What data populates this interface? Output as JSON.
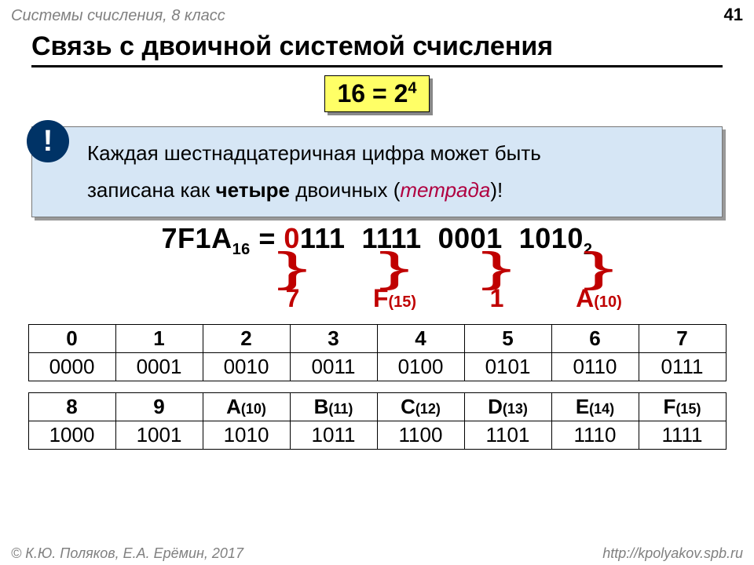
{
  "header": {
    "course": "Системы счисления, 8 класс",
    "page": "41"
  },
  "title": "Связь с двоичной системой счисления",
  "equation": {
    "lhs": "16 = 2",
    "exp": "4"
  },
  "info": {
    "bang": "!",
    "line1": "Каждая шестнадцатеричная цифра может быть",
    "line2a": "записана как ",
    "line2b": "четыре",
    "line2c": " двоичных (",
    "line2d": "тетрада",
    "line2e": ")!"
  },
  "hexline": {
    "lhs": "7F1A",
    "lhs_sub": "16",
    "eq": " = ",
    "lead": "0",
    "g1": "111",
    "sp": "  ",
    "g2": "1111",
    "g3": "0001",
    "g4": "1010",
    "rhs_sub": "2"
  },
  "groups": [
    {
      "label": "7",
      "sub": ""
    },
    {
      "label": "F",
      "sub": "(15)"
    },
    {
      "label": "1",
      "sub": ""
    },
    {
      "label": "A",
      "sub": "(10)"
    }
  ],
  "table1": {
    "head": [
      "0",
      "1",
      "2",
      "3",
      "4",
      "5",
      "6",
      "7"
    ],
    "row": [
      "0000",
      "0001",
      "0010",
      "0011",
      "0100",
      "0101",
      "0110",
      "0111"
    ]
  },
  "table2": {
    "head": [
      {
        "t": "8",
        "s": ""
      },
      {
        "t": "9",
        "s": ""
      },
      {
        "t": "A",
        "s": "(10)"
      },
      {
        "t": "B",
        "s": "(11)"
      },
      {
        "t": "C",
        "s": "(12)"
      },
      {
        "t": "D",
        "s": "(13)"
      },
      {
        "t": "E",
        "s": "(14)"
      },
      {
        "t": "F",
        "s": "(15)"
      }
    ],
    "row": [
      "1000",
      "1001",
      "1010",
      "1011",
      "1100",
      "1101",
      "1110",
      "1111"
    ]
  },
  "footer": {
    "left": "© К.Ю. Поляков, Е.А. Ерёмин, 2017",
    "right": "http://kpolyakov.spb.ru"
  },
  "brace_glyph": "}"
}
